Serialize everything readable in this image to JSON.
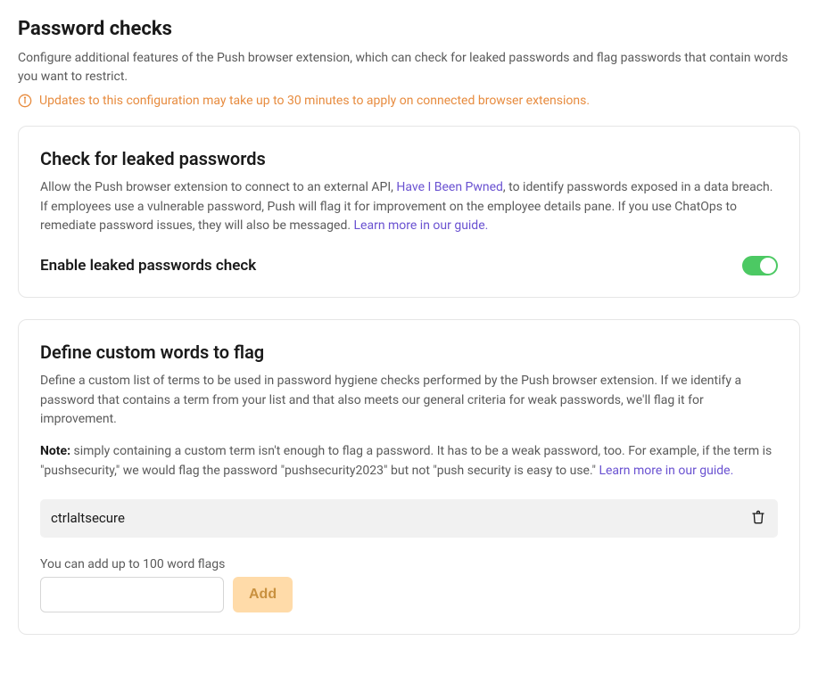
{
  "page": {
    "title": "Password checks",
    "description": "Configure additional features of the Push browser extension, which can check for leaked passwords and flag passwords that contain words you want to restrict.",
    "notice": "Updates to this configuration may take up to 30 minutes to apply on connected browser extensions."
  },
  "card_leaked": {
    "title": "Check for leaked passwords",
    "desc_pre": "Allow the Push browser extension to connect to an external API, ",
    "desc_link": "Have I Been Pwned",
    "desc_post": ", to identify passwords exposed in a data breach. If employees use a vulnerable password, Push will flag it for improvement on the employee details pane. If you use ChatOps to remediate password issues, they will also be messaged. ",
    "learn_more": "Learn more in our guide.",
    "toggle_label": "Enable leaked passwords check",
    "toggle_on": true
  },
  "card_custom": {
    "title": "Define custom words to flag",
    "description": "Define a custom list of terms to be used in password hygiene checks performed by the Push browser extension. If we identify a password that contains a term from your list and that also meets our general criteria for weak passwords, we'll flag it for improvement.",
    "note_label": "Note:",
    "note_text": " simply containing a custom term isn't enough to flag a password. It has to be a weak password, too. For example, if the term is \"pushsecurity,\" we would flag the password \"pushsecurity2023\" but not \"push security is easy to use.\" ",
    "learn_more": "Learn more in our guide.",
    "words": [
      "ctrlaltsecure"
    ],
    "add_helper": "You can add up to 100 word flags",
    "add_button": "Add"
  }
}
